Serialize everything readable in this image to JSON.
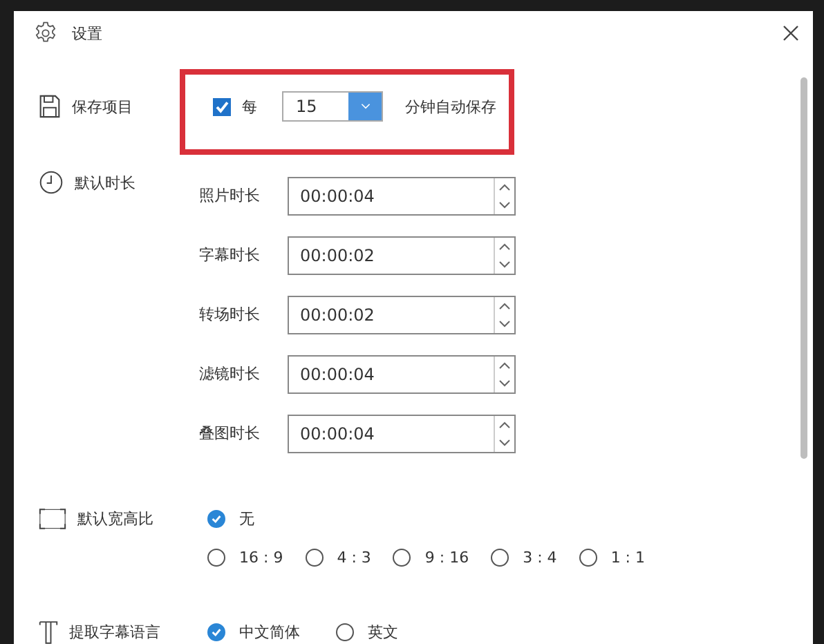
{
  "window": {
    "title": "设置"
  },
  "autosave": {
    "label": "保存项目",
    "highlighted": true,
    "checked": true,
    "prefix": "每",
    "minutes": "15",
    "suffix": "分钟自动保存"
  },
  "durations": {
    "label": "默认时长",
    "items": [
      {
        "label": "照片时长",
        "value": "00:00:04"
      },
      {
        "label": "字幕时长",
        "value": "00:00:02"
      },
      {
        "label": "转场时长",
        "value": "00:00:02"
      },
      {
        "label": "滤镜时长",
        "value": "00:00:04"
      },
      {
        "label": "叠图时长",
        "value": "00:00:04"
      }
    ]
  },
  "aspect": {
    "label": "默认宽高比",
    "options": [
      {
        "label": "无",
        "selected": true
      },
      {
        "label": "16 : 9",
        "selected": false
      },
      {
        "label": "4 : 3",
        "selected": false
      },
      {
        "label": "9 : 16",
        "selected": false
      },
      {
        "label": "3 : 4",
        "selected": false
      },
      {
        "label": "1 : 1",
        "selected": false
      }
    ]
  },
  "subtitle_language": {
    "label": "提取字幕语言",
    "options": [
      {
        "label": "中文简体",
        "selected": true
      },
      {
        "label": "英文",
        "selected": false
      }
    ]
  }
}
